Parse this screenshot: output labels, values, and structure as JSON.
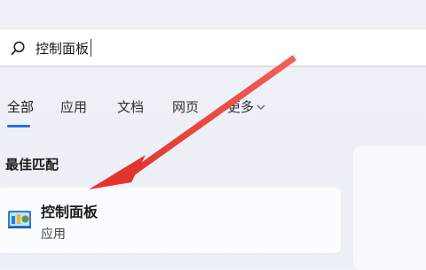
{
  "search": {
    "value": "控制面板",
    "icon": "search-icon"
  },
  "tabs": [
    {
      "label": "全部",
      "active": true
    },
    {
      "label": "应用"
    },
    {
      "label": "文档"
    },
    {
      "label": "网页"
    },
    {
      "label": "更多",
      "has_chevron": true
    }
  ],
  "best_match": {
    "section_title": "最佳匹配",
    "title": "控制面板",
    "subtitle": "应用",
    "icon": "control-panel-icon"
  },
  "colors": {
    "accent": "#2d6fd1",
    "annotation_arrow": "#e8403a",
    "background": "#edf1f7"
  }
}
